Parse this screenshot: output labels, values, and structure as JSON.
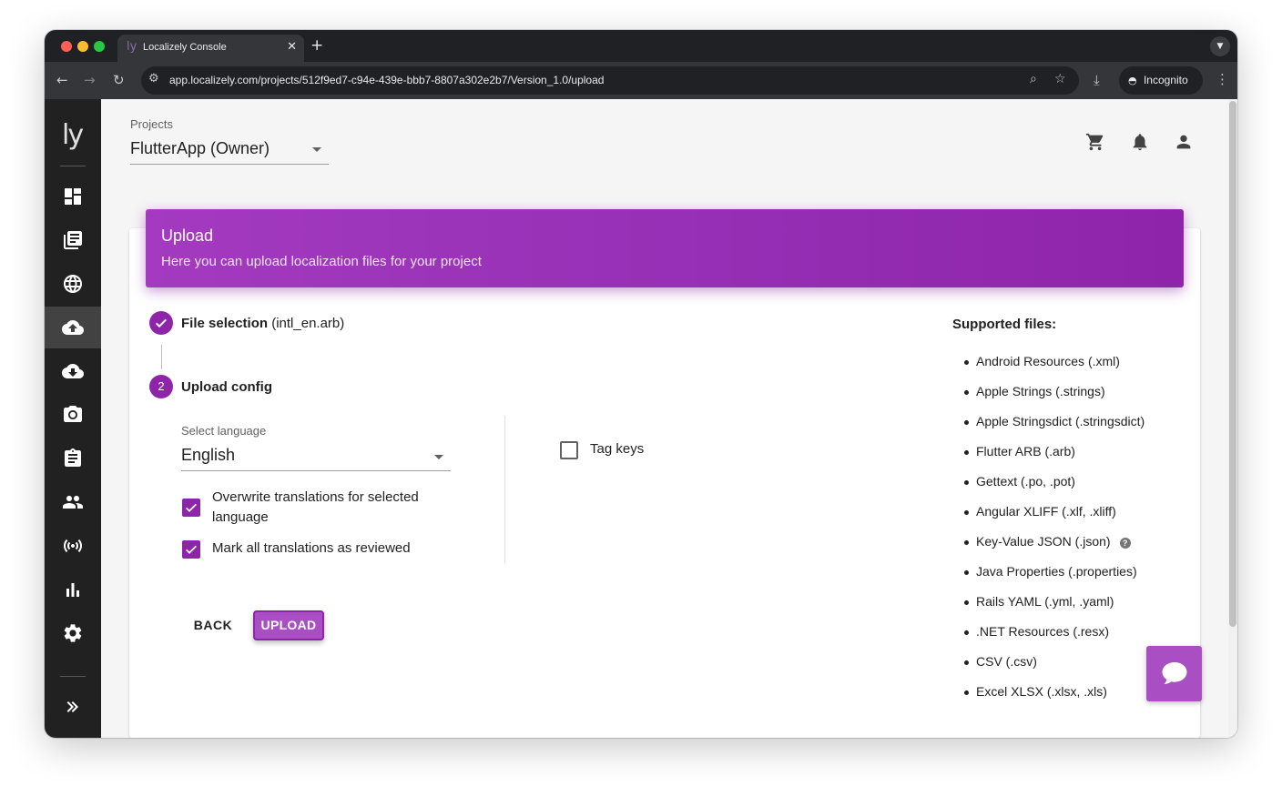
{
  "browser": {
    "tab_favicon": "ly",
    "tab_title": "Localizely Console",
    "url": "app.localizely.com/projects/512f9ed7-c94e-439e-bbb7-8807a302e2b7/Version_1.0/upload",
    "incognito_label": "Incognito"
  },
  "sidebar": {
    "logo": "ly",
    "active_item": "upload",
    "items": [
      "dashboard",
      "library",
      "globe",
      "upload",
      "download",
      "camera",
      "clipboard",
      "people",
      "broadcast",
      "bar-chart",
      "settings"
    ]
  },
  "header": {
    "projects_label": "Projects",
    "project_value": "FlutterApp (Owner)"
  },
  "banner": {
    "title": "Upload",
    "subtitle": "Here you can upload localization files for your project"
  },
  "steps": {
    "step1_title": "File selection",
    "step1_detail": "(intl_en.arb)",
    "step2_number": "2",
    "step2_title": "Upload config"
  },
  "form": {
    "language_label": "Select language",
    "language_value": "English",
    "overwrite_label": "Overwrite translations for selected language",
    "overwrite_checked": true,
    "reviewed_label": "Mark all translations as reviewed",
    "reviewed_checked": true,
    "tag_keys_label": "Tag keys",
    "tag_keys_checked": false
  },
  "actions": {
    "back_label": "BACK",
    "upload_label": "UPLOAD"
  },
  "supported": {
    "title": "Supported files:",
    "files": [
      "Android Resources (.xml)",
      "Apple Strings (.strings)",
      "Apple Stringsdict (.stringsdict)",
      "Flutter ARB (.arb)",
      "Gettext (.po, .pot)",
      "Angular XLIFF (.xlf, .xliff)",
      "Key-Value JSON (.json)",
      "Java Properties (.properties)",
      "Rails YAML (.yml, .yaml)",
      ".NET Resources (.resx)",
      "CSV (.csv)",
      "Excel XLSX (.xlsx, .xls)"
    ]
  },
  "colors": {
    "accent": "#8e24aa",
    "sidebar_bg": "#212121"
  }
}
